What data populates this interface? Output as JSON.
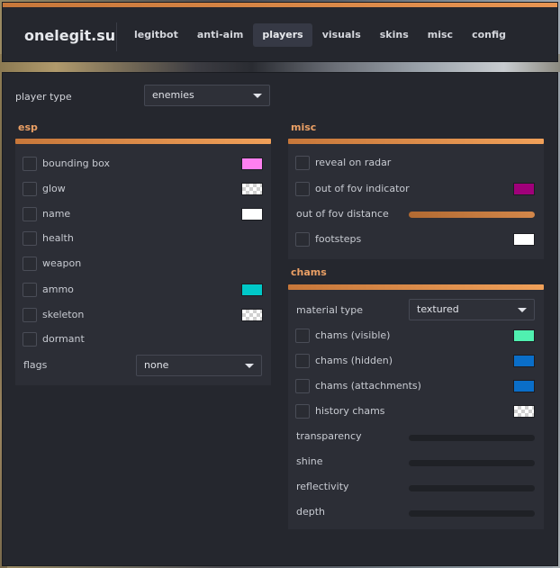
{
  "app": {
    "logo": "onelegit.su"
  },
  "nav": {
    "items": [
      {
        "label": "legitbot",
        "active": false
      },
      {
        "label": "anti-aim",
        "active": false
      },
      {
        "label": "players",
        "active": true
      },
      {
        "label": "visuals",
        "active": false
      },
      {
        "label": "skins",
        "active": false
      },
      {
        "label": "misc",
        "active": false
      },
      {
        "label": "config",
        "active": false
      }
    ]
  },
  "player_type": {
    "label": "player type",
    "value": "enemies"
  },
  "esp": {
    "title": "esp",
    "items": [
      {
        "label": "bounding box",
        "color": "#ff80f0"
      },
      {
        "label": "glow",
        "color": "checker"
      },
      {
        "label": "name",
        "color": "#ffffff"
      },
      {
        "label": "health"
      },
      {
        "label": "weapon"
      },
      {
        "label": "ammo",
        "color": "#00c8c8"
      },
      {
        "label": "skeleton",
        "color": "checker"
      },
      {
        "label": "dormant"
      }
    ],
    "flags": {
      "label": "flags",
      "value": "none"
    }
  },
  "misc": {
    "title": "misc",
    "reveal_on_radar": {
      "label": "reveal on radar"
    },
    "out_of_fov_indicator": {
      "label": "out of fov indicator",
      "color": "#a0007a"
    },
    "out_of_fov_distance": {
      "label": "out of fov distance",
      "value": 1.0
    },
    "footsteps": {
      "label": "footsteps",
      "color": "#ffffff"
    }
  },
  "chams": {
    "title": "chams",
    "material_type": {
      "label": "material type",
      "value": "textured"
    },
    "visible": {
      "label": "chams (visible)",
      "color": "#50f0b0"
    },
    "hidden": {
      "label": "chams (hidden)",
      "color": "#0a6ec8"
    },
    "attachments": {
      "label": "chams (attachments)",
      "color": "#0a6ec8"
    },
    "history": {
      "label": "history chams",
      "color": "checker"
    },
    "sliders": [
      {
        "label": "transparency",
        "value": 0
      },
      {
        "label": "shine",
        "value": 0
      },
      {
        "label": "reflectivity",
        "value": 0
      },
      {
        "label": "depth",
        "value": 0
      }
    ]
  }
}
